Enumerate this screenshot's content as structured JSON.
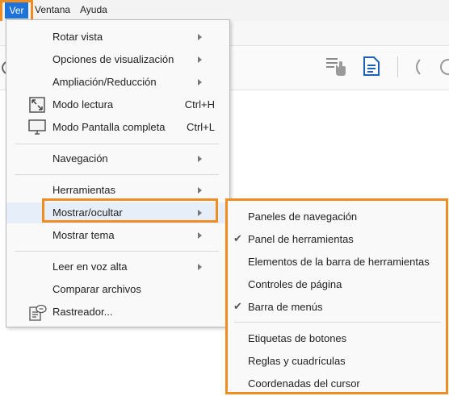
{
  "menubar": {
    "items": [
      {
        "label": "Ver"
      },
      {
        "label": "Ventana"
      },
      {
        "label": "Ayuda"
      }
    ]
  },
  "menu": {
    "items": [
      {
        "label": "Rotar vista"
      },
      {
        "label": "Opciones de visualización"
      },
      {
        "label": "Ampliación/Reducción"
      },
      {
        "label": "Modo lectura",
        "shortcut": "Ctrl+H"
      },
      {
        "label": "Modo Pantalla completa",
        "shortcut": "Ctrl+L"
      },
      {
        "label": "Navegación"
      },
      {
        "label": "Herramientas"
      },
      {
        "label": "Mostrar/ocultar"
      },
      {
        "label": "Mostrar tema"
      },
      {
        "label": "Leer en voz alta"
      },
      {
        "label": "Comparar archivos"
      },
      {
        "label": "Rastreador..."
      }
    ]
  },
  "submenu": {
    "items": [
      {
        "label": "Paneles de navegación",
        "checked": false
      },
      {
        "label": "Panel de herramientas",
        "checked": true
      },
      {
        "label": "Elementos de la barra de herramientas",
        "checked": false
      },
      {
        "label": "Controles de página",
        "checked": false
      },
      {
        "label": "Barra de menús",
        "checked": true
      },
      {
        "label": "Etiquetas de botones",
        "checked": false
      },
      {
        "label": "Reglas y cuadrículas",
        "checked": false
      },
      {
        "label": "Coordenadas del cursor",
        "checked": false
      }
    ],
    "check_glyph": "✔"
  },
  "colors": {
    "highlight_border": "#ef8d22",
    "active_menu": "#1e73d9",
    "hover_bg": "#e5eef9"
  }
}
